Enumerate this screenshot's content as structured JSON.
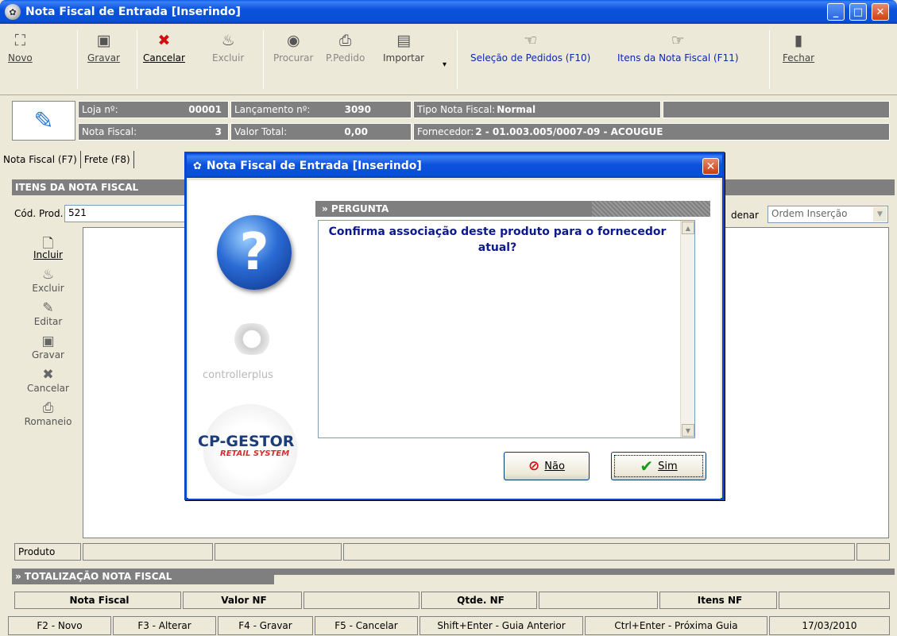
{
  "window": {
    "title": "Nota Fiscal de Entrada [Inserindo]"
  },
  "toolbar": {
    "novo": "Novo",
    "gravar": "Gravar",
    "cancelar": "Cancelar",
    "excluir": "Excluir",
    "procurar": "Procurar",
    "ppedido": "P.Pedido",
    "importar": "Importar",
    "selecao": "Seleção de Pedidos (F10)",
    "itens": "Itens da Nota Fiscal (F11)",
    "fechar": "Fechar"
  },
  "info": {
    "loja_label": "Loja nº:",
    "loja_value": "00001",
    "lanc_label": "Lançamento nº:",
    "lanc_value": "3090",
    "tipo_label": "Tipo Nota Fiscal:",
    "tipo_value": "Normal",
    "nf_label": "Nota Fiscal:",
    "nf_value": "3",
    "valor_label": "Valor Total:",
    "valor_value": "0,00",
    "forn_label": "Fornecedor:",
    "forn_value": "2 - 01.003.005/0007-09 - ACOUGUE"
  },
  "tabs": [
    "Nota Fiscal (F7)",
    "Frete (F8)"
  ],
  "items": {
    "header": "ITENS DA NOTA FISCAL",
    "cod_label": "Cód. Prod.",
    "cod_value": "521",
    "ordenar_label": "denar",
    "ordem_value": "Ordem Inserção"
  },
  "sidebar": {
    "incluir": "Incluir",
    "excluir": "Excluir",
    "editar": "Editar",
    "gravar": "Gravar",
    "cancelar": "Cancelar",
    "romaneio": "Romaneio"
  },
  "bottom": {
    "produto": "Produto",
    "totalizacao": "» TOTALIZAÇÃO NOTA FISCAL",
    "col_nf": "Nota Fiscal",
    "col_valor": "Valor NF",
    "col_qtde": "Qtde. NF",
    "col_itens": "Itens NF"
  },
  "status": [
    "F2 - Novo",
    "F3 - Alterar",
    "F4 - Gravar",
    "F5 - Cancelar",
    "Shift+Enter - Guia Anterior",
    "Ctrl+Enter - Próxima Guia",
    "17/03/2010"
  ],
  "dialog": {
    "title": "Nota Fiscal de Entrada [Inserindo]",
    "section": "» PERGUNTA",
    "message": "Confirma associação deste produto para o fornecedor atual?",
    "no": "Não",
    "yes": "Sim",
    "brand1": "controllerplus",
    "brand2": "CP-GESTOR",
    "brand2_sub": "RETAIL SYSTEM"
  }
}
